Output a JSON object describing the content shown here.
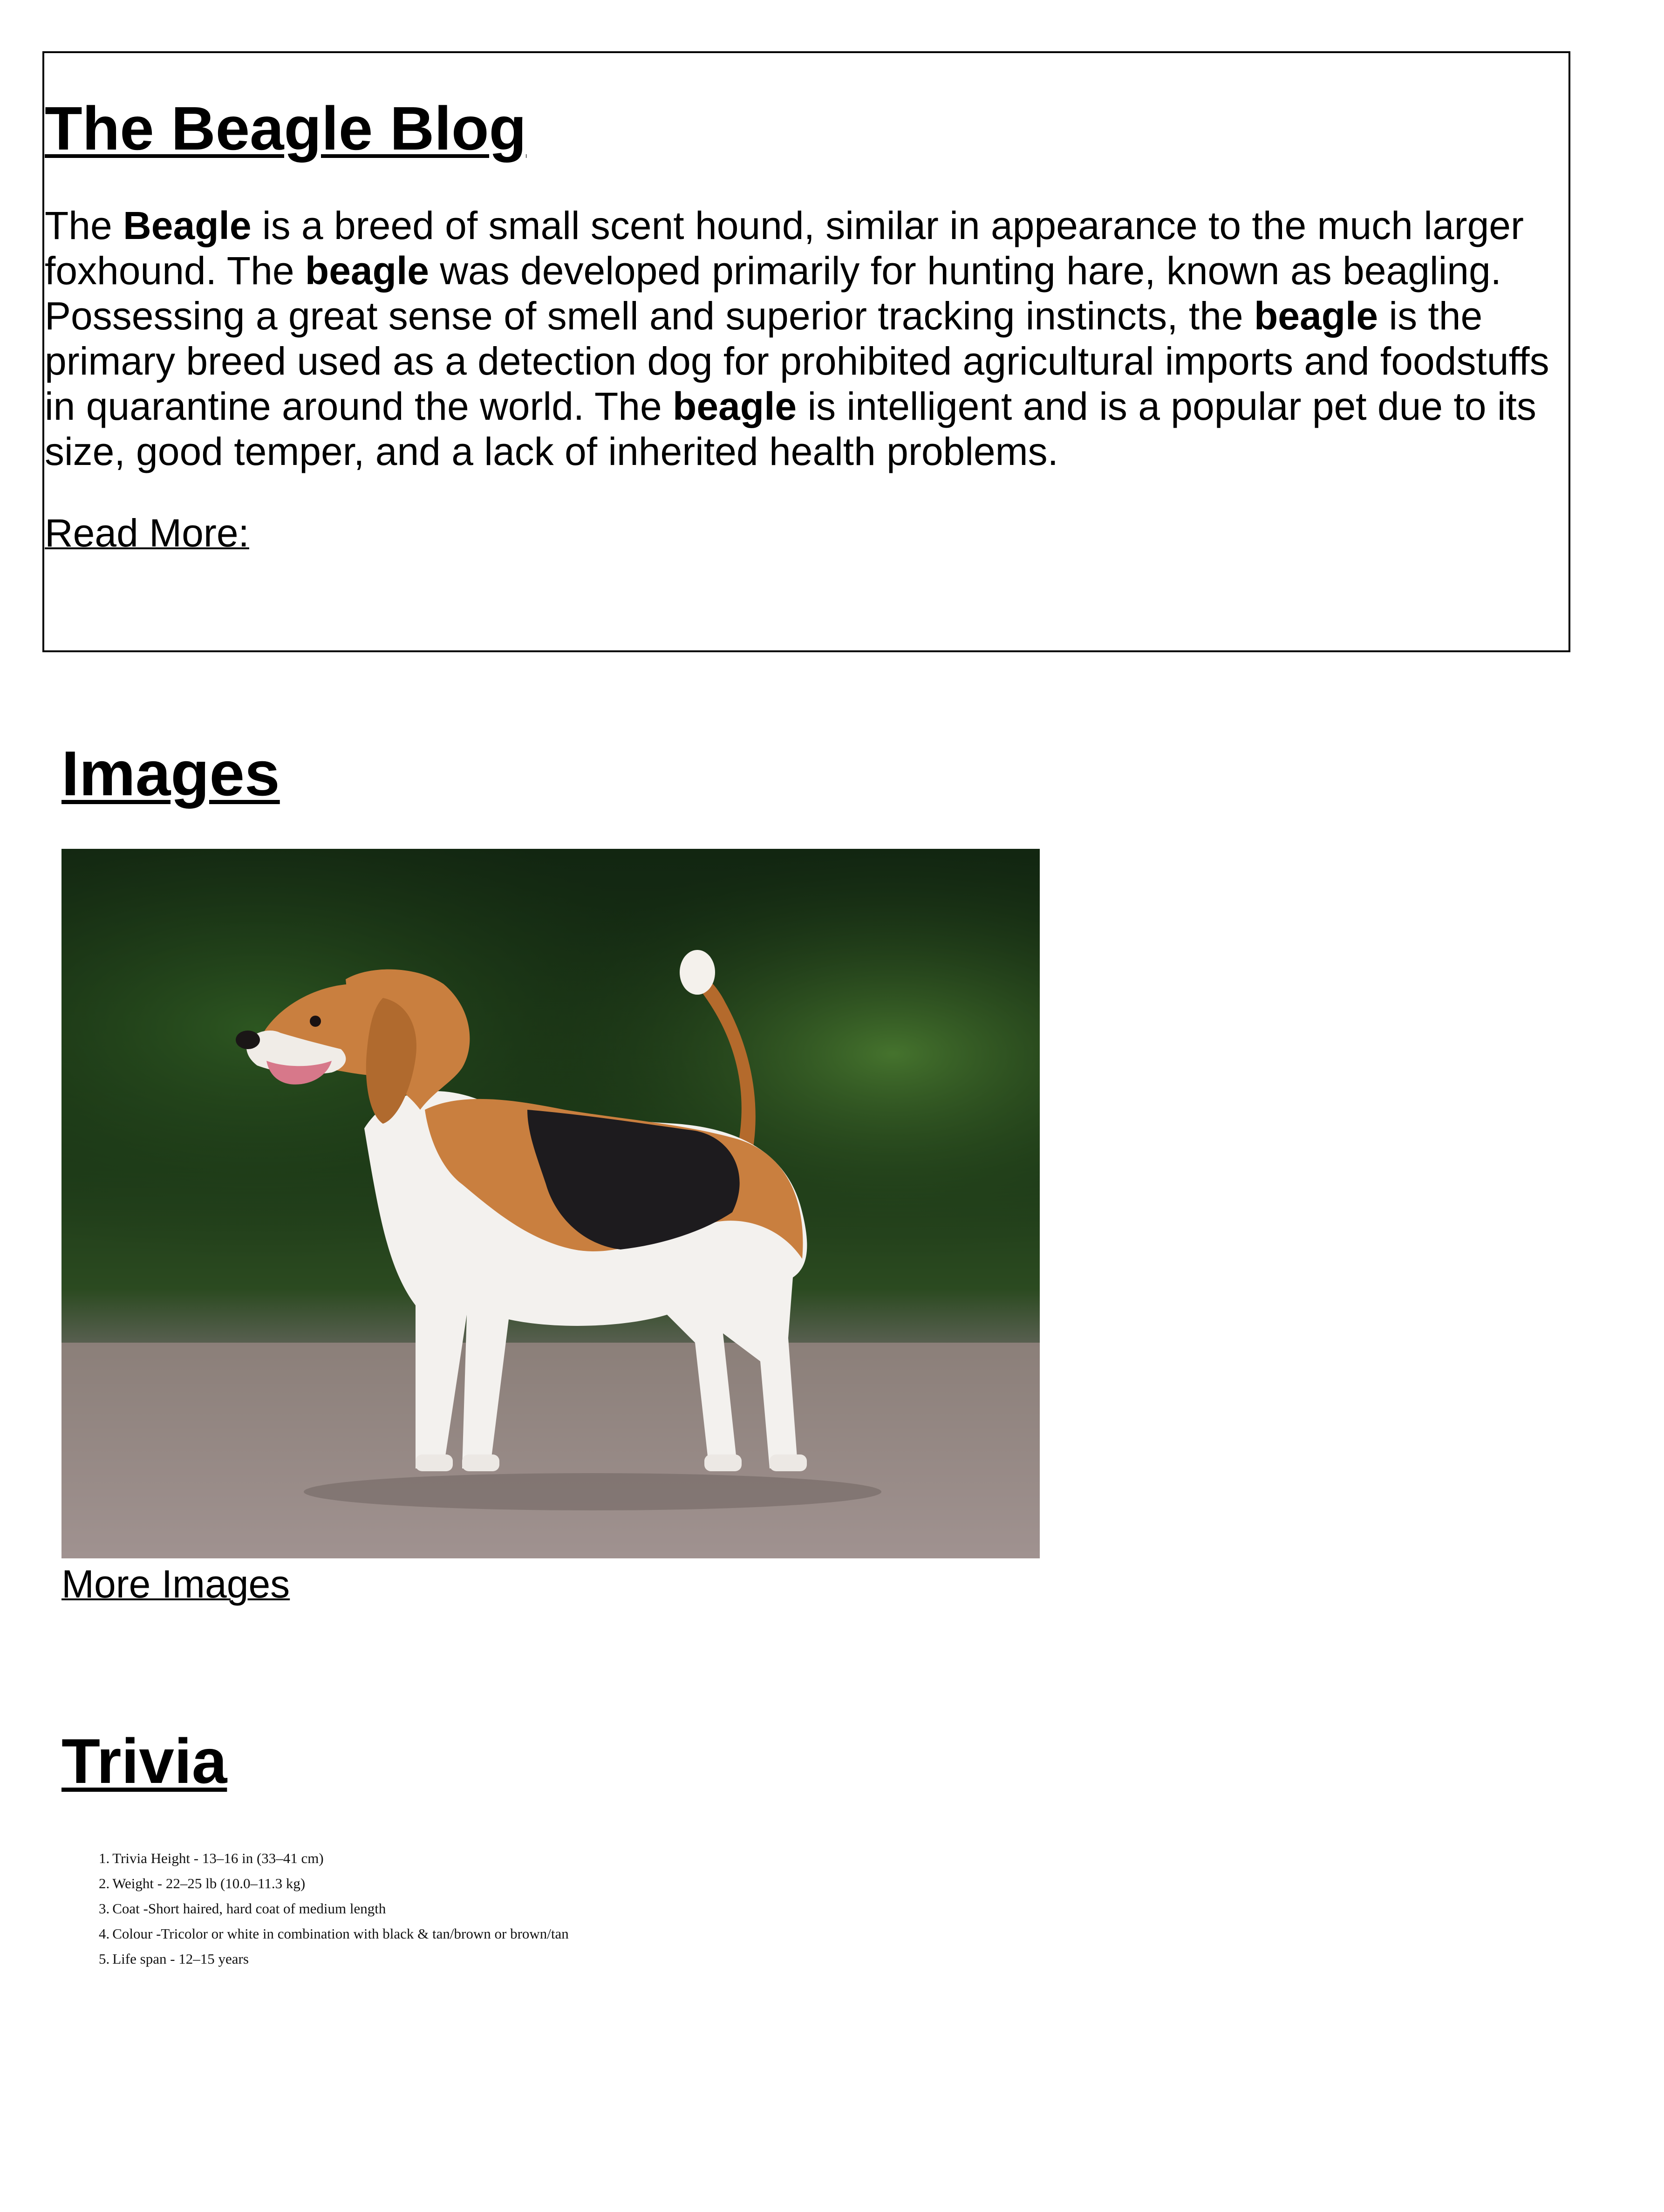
{
  "blog": {
    "title": "The Beagle Blog",
    "intro": {
      "p1": "The ",
      "b1": "Beagle",
      "p2": " is a breed of small scent hound, similar in appearance to the much larger foxhound. The ",
      "b2": "beagle",
      "p3": " was developed primarily for hunting hare, known as beagling. Possessing a great sense of smell and superior tracking instincts, the ",
      "b3": "beagle",
      "p4": " is the primary breed used as a detection dog for prohibited agricultural imports and foodstuffs in quarantine around the world. The ",
      "b4": "beagle",
      "p5": " is intelligent and is a popular pet due to its size, good temper, and a lack of inherited health problems."
    },
    "read_more_label": "Read More:"
  },
  "images": {
    "heading": "Images",
    "photo_icon": "beagle-photo",
    "more_label": "More Images"
  },
  "trivia": {
    "heading": "Trivia",
    "items": [
      {
        "num": "1.",
        "text": "Trivia Height - 13–16 in (33–41 cm)"
      },
      {
        "num": "2.",
        "text": "Weight - 22–25 lb (10.0–11.3 kg)"
      },
      {
        "num": "3.",
        "text": "Coat -Short haired, hard coat of medium length"
      },
      {
        "num": "4.",
        "text": "Colour -Tricolor or white in combination with black & tan/brown or brown/tan"
      },
      {
        "num": "5.",
        "text": "Life span - 12–15 years"
      }
    ]
  },
  "colors": {
    "text": "#000000",
    "border": "#000000",
    "background": "#ffffff"
  }
}
